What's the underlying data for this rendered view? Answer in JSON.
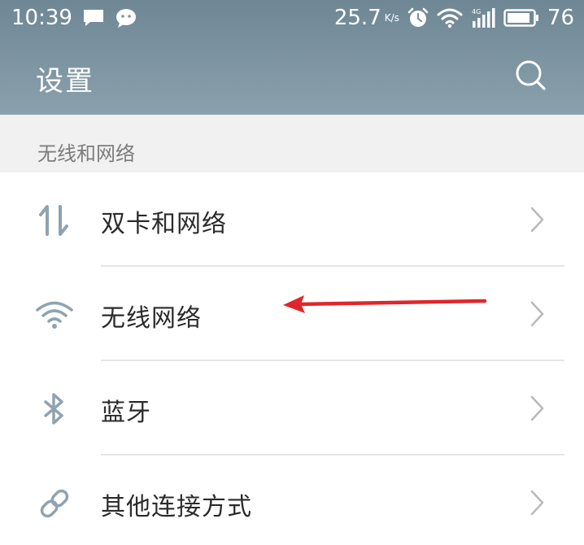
{
  "status_bar": {
    "time": "10:39",
    "left_icons": [
      "message-icon",
      "chat-bubble-icon"
    ],
    "network_speed": "25.7",
    "network_speed_unit": "K/s",
    "right_icons": [
      "alarm-icon",
      "wifi-icon",
      "signal-icon",
      "battery-icon"
    ],
    "battery": "76"
  },
  "app_bar": {
    "title": "设置",
    "search_icon": "search-icon"
  },
  "section": {
    "title": "无线和网络"
  },
  "items": [
    {
      "label": "双卡和网络",
      "icon": "data-transfer-icon"
    },
    {
      "label": "无线网络",
      "icon": "wifi-icon"
    },
    {
      "label": "蓝牙",
      "icon": "bluetooth-icon"
    },
    {
      "label": "其他连接方式",
      "icon": "link-icon"
    }
  ],
  "colors": {
    "app_bar": "#7d94a2",
    "section_header_bg": "#f1f1f1",
    "icon_accent": "#8fa3b0",
    "annotation_arrow": "#e0262a"
  }
}
